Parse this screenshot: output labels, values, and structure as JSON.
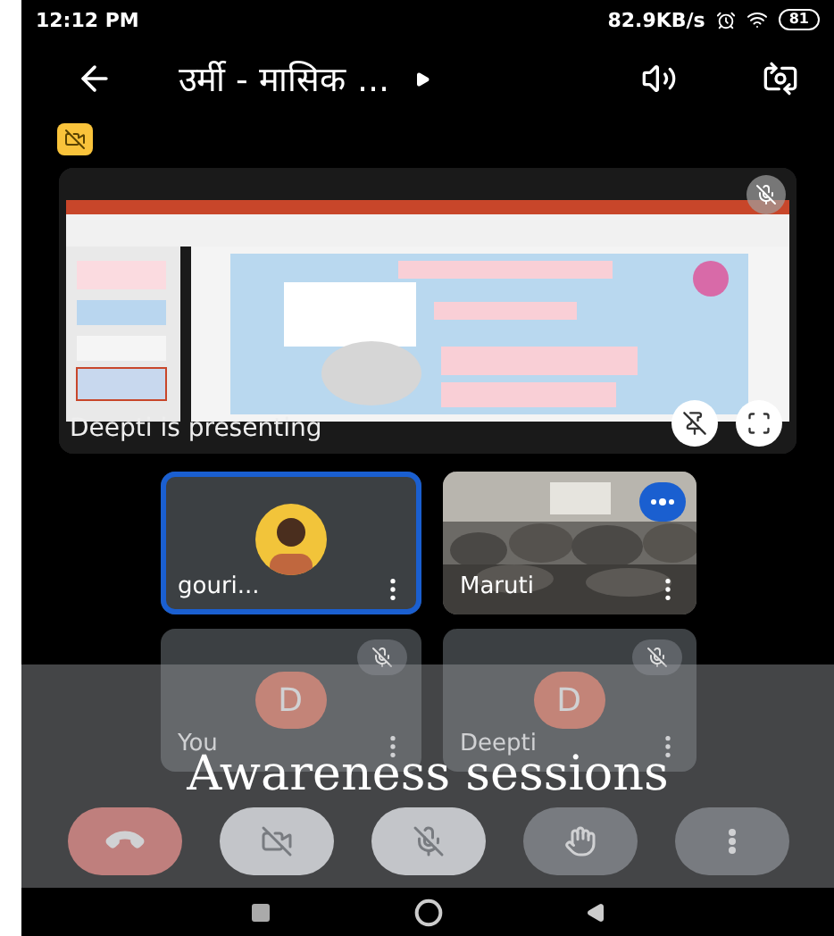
{
  "status_bar": {
    "time": "12:12 PM",
    "speed": "82.9KB/s",
    "battery": "81"
  },
  "header": {
    "title": "उर्मी - मासिक ...",
    "camera_off": true
  },
  "presentation": {
    "caption": "Deepti is presenting",
    "muted": true
  },
  "participants": [
    {
      "name": "gouri...",
      "kind": "avatar",
      "highlighted": true,
      "audio_active": false,
      "muted": false
    },
    {
      "name": "Maruti",
      "kind": "video",
      "highlighted": false,
      "audio_active": true,
      "muted": false
    },
    {
      "name": "You",
      "kind": "letter",
      "initial": "D",
      "highlighted": false,
      "audio_active": false,
      "muted": true
    },
    {
      "name": "Deepti",
      "kind": "letter",
      "initial": "D",
      "highlighted": false,
      "audio_active": false,
      "muted": true
    }
  ],
  "controls": [
    {
      "kind": "hangup"
    },
    {
      "kind": "camera",
      "on": false
    },
    {
      "kind": "mic",
      "on": false
    },
    {
      "kind": "hand"
    },
    {
      "kind": "more"
    }
  ],
  "caption": "Awareness sessions"
}
